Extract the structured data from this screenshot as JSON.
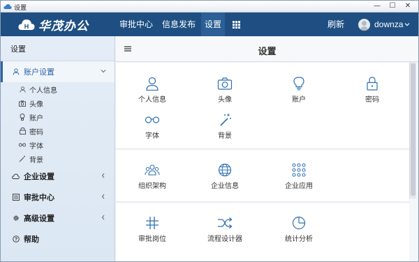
{
  "window": {
    "title": "设置",
    "controls": [
      "—",
      "☐",
      "✕"
    ]
  },
  "topnav": {
    "logo_text": "华茂办公",
    "items": [
      "审批中心",
      "信息发布",
      "设置"
    ],
    "active": "设置",
    "refresh": "刷新",
    "username": "downza"
  },
  "sidebar": {
    "header": "设置",
    "groups": [
      {
        "label": "账户设置",
        "icon": "user-icon",
        "expanded": true,
        "children": [
          {
            "label": "个人信息",
            "icon": "user-icon"
          },
          {
            "label": "头像",
            "icon": "camera-icon"
          },
          {
            "label": "账户",
            "icon": "bulb-icon"
          },
          {
            "label": "密码",
            "icon": "lock-icon"
          },
          {
            "label": "字体",
            "icon": "glasses-icon"
          },
          {
            "label": "背景",
            "icon": "wand-icon"
          }
        ]
      },
      {
        "label": "企业设置",
        "icon": "cloud-icon"
      },
      {
        "label": "审批中心",
        "icon": "list-icon"
      },
      {
        "label": "高级设置",
        "icon": "gear-icon"
      },
      {
        "label": "帮助",
        "icon": "help-icon"
      }
    ]
  },
  "main": {
    "title": "设置",
    "panels": [
      {
        "tiles": [
          "个人信息",
          "头像",
          "账户",
          "密码",
          "字体",
          "背景"
        ]
      },
      {
        "tiles": [
          "组织架构",
          "企业信息",
          "企业应用"
        ]
      },
      {
        "tiles": [
          "审批岗位",
          "流程设计器",
          "统计分析"
        ]
      }
    ]
  },
  "colors": {
    "topnav": "#1f4f82",
    "accent": "#2b63a7",
    "icon": "#2f6fb0"
  }
}
